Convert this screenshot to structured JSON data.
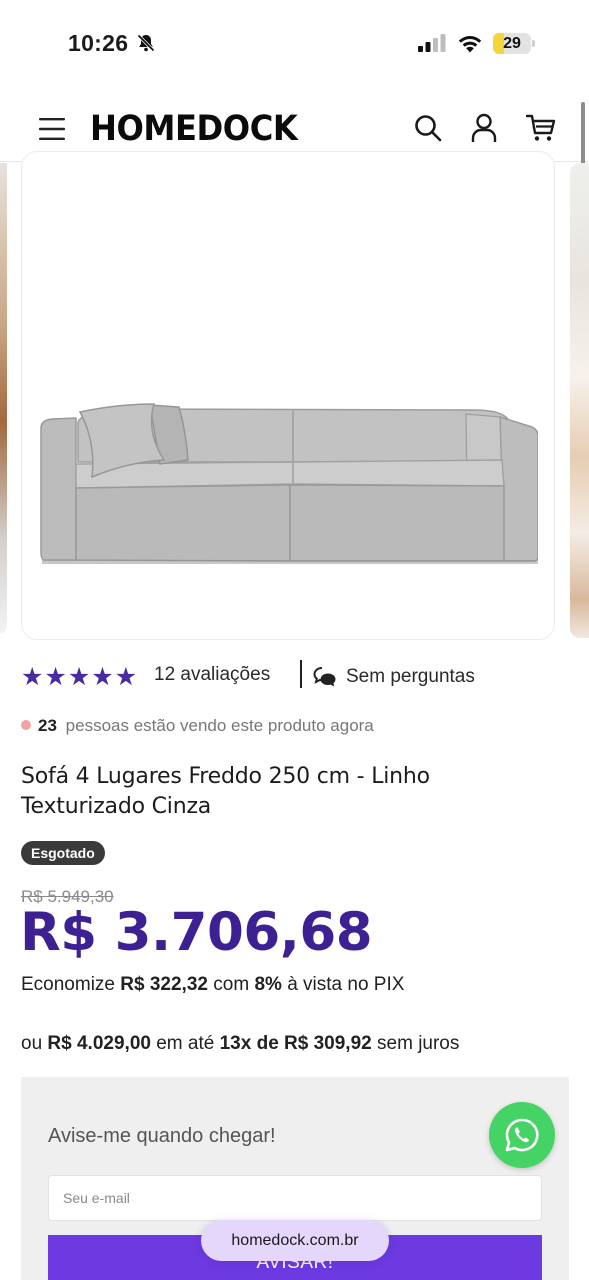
{
  "status_bar": {
    "time": "10:26",
    "battery": "29",
    "battery_level": 0.29
  },
  "header": {
    "logo": "HOMEDOCK"
  },
  "product": {
    "rating_stars": "★★★★★",
    "reviews_label": "12 avaliações",
    "questions_label": "Sem perguntas",
    "viewers_count": "23",
    "viewers_text": "pessoas estão vendo este produto agora",
    "title": "Sofá 4 Lugares Freddo 250 cm - Linho Texturizado Cinza",
    "badge": "Esgotado",
    "old_price": "R$ 5.949,30",
    "price": "R$ 3.706,68",
    "pix": {
      "prefix": "Economize",
      "amount": "R$ 322,32",
      "mid": "com",
      "percent": "8%",
      "suffix": "à vista no PIX"
    },
    "installments": {
      "prefix": "ou",
      "total": "R$ 4.029,00",
      "mid": "em até",
      "plan": "13x de R$ 309,92",
      "suffix": "sem juros"
    }
  },
  "notify": {
    "title": "Avise-me quando chegar!",
    "email_placeholder": "Seu e-mail",
    "button_label": "AVISAR!"
  },
  "browser": {
    "url": "homedock.com.br"
  },
  "colors": {
    "accent": "#3d2193",
    "button": "#6c3ae0",
    "whatsapp": "#45d366"
  }
}
